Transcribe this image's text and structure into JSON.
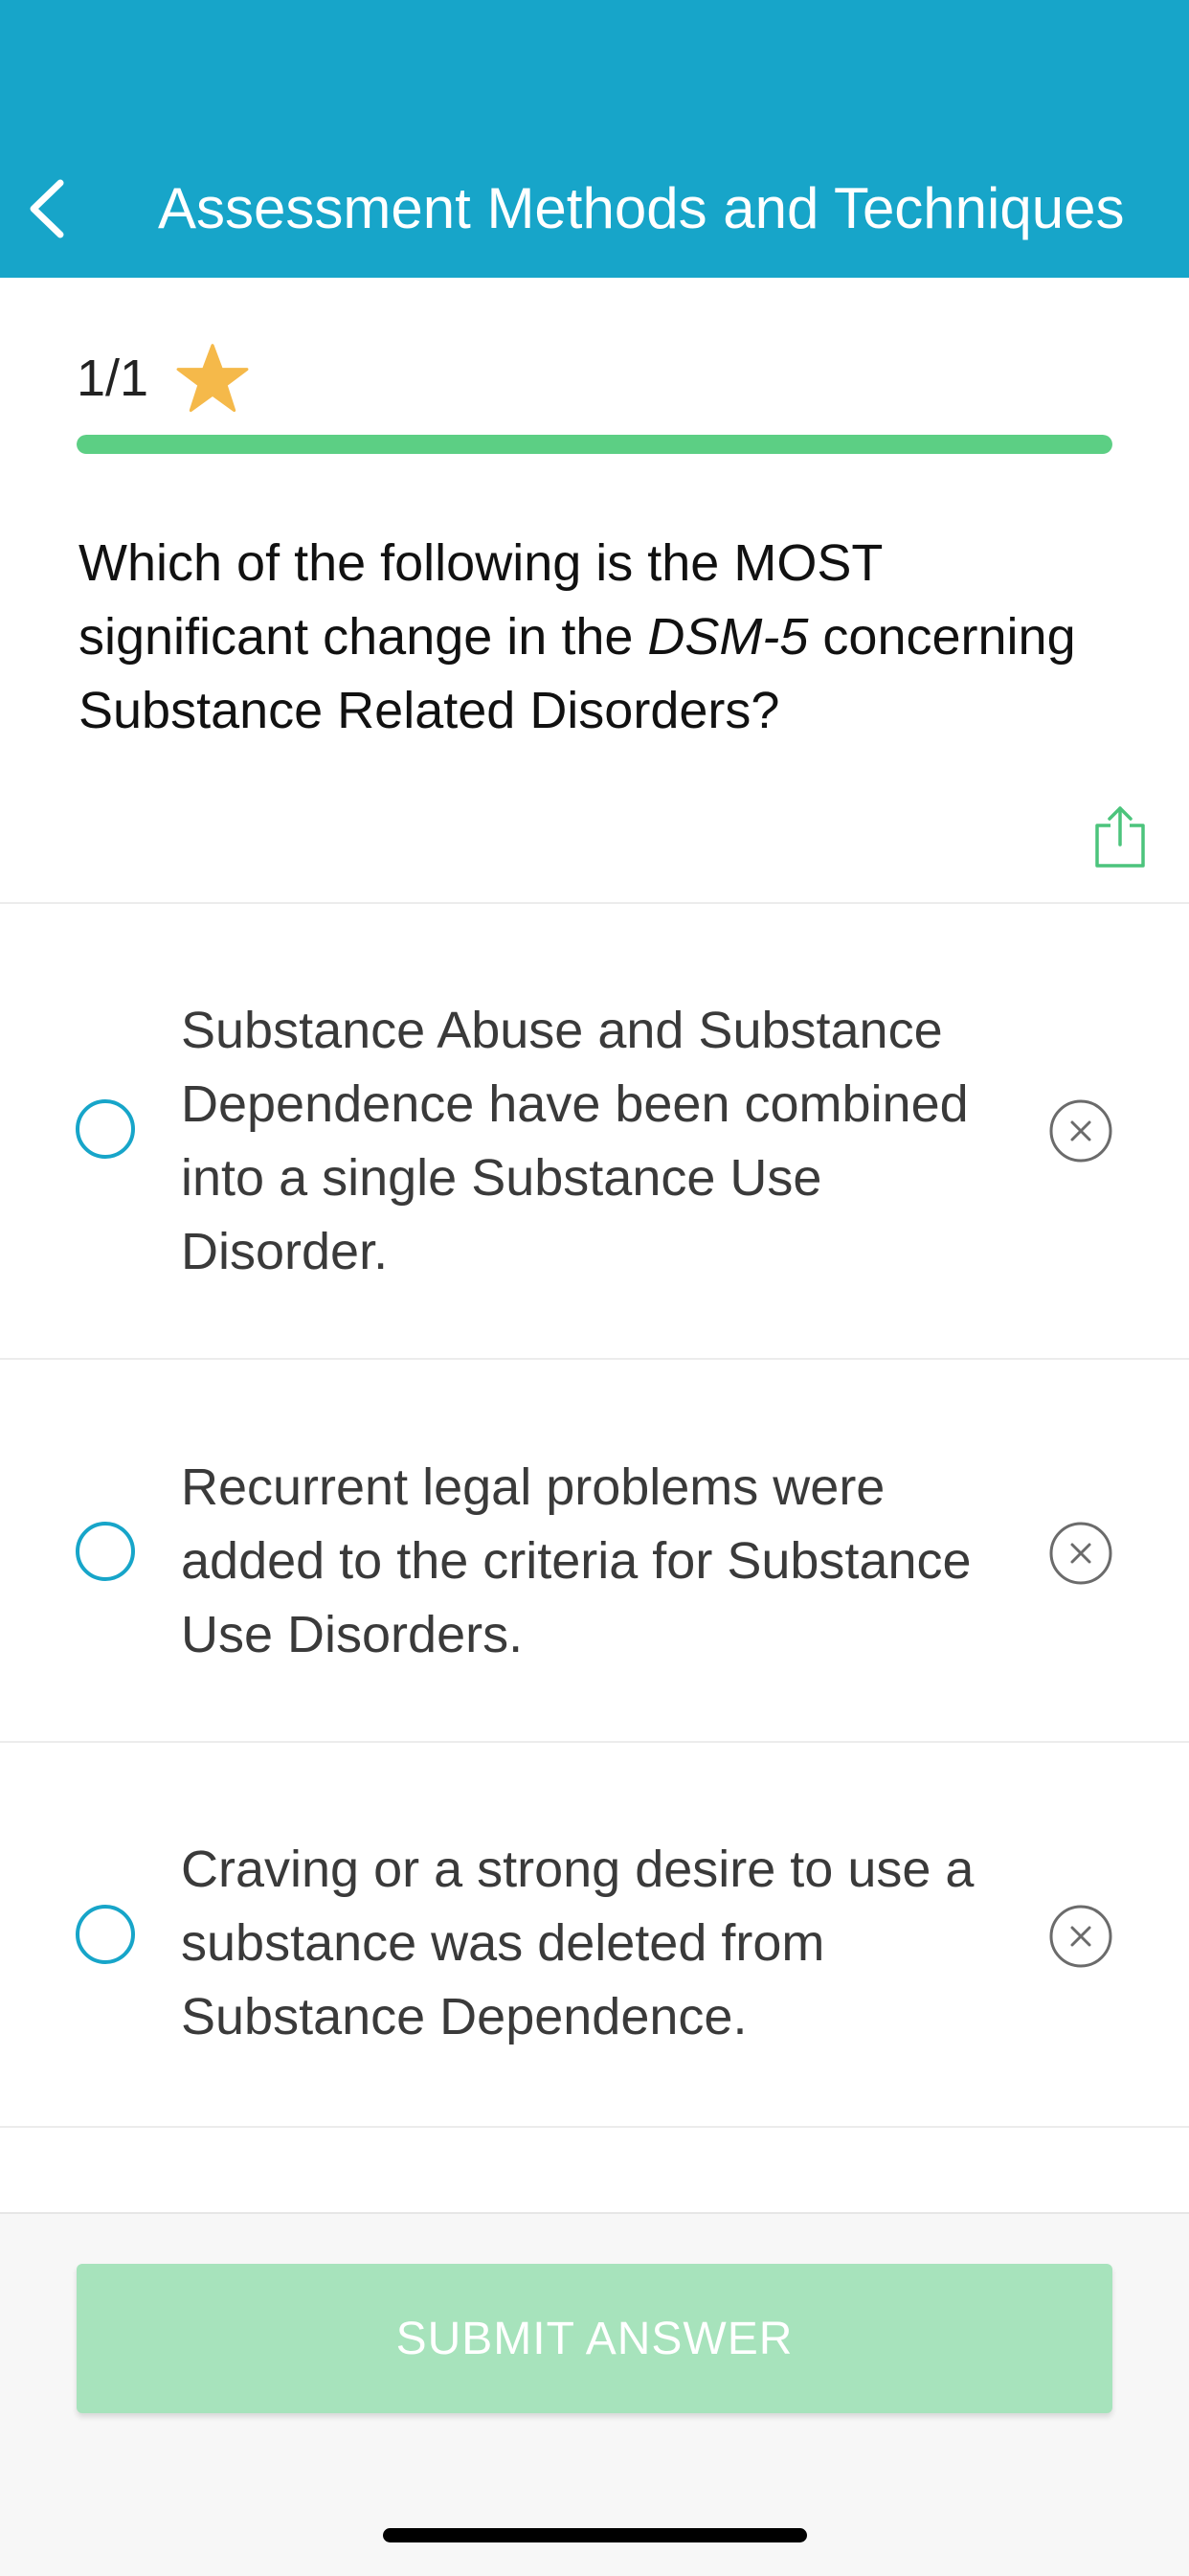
{
  "header": {
    "title": "Assessment Methods and Techniques",
    "back_icon": "chevron-left-icon",
    "background": "#17a5c9"
  },
  "progress": {
    "counter": "1/1",
    "fraction": 1.0,
    "star_icon": "star-icon",
    "star_color": "#f5b94a",
    "bar_color": "#5ccf84"
  },
  "question": {
    "text_before": "Which of the following is the MOST significant change in the ",
    "text_italic": "DSM-5",
    "text_after": " concerning Substance Related Disorders?",
    "share_icon": "share-icon"
  },
  "options": [
    {
      "text": "Substance Abuse and Substance Dependence have been combined into a single Substance Use Disorder."
    },
    {
      "text": "Recurrent legal problems were added to the criteria for Substance Use Disorders."
    },
    {
      "text": "Craving or a strong desire to use a substance was deleted from Substance Dependence."
    }
  ],
  "footer": {
    "submit_label": "SUBMIT ANSWER",
    "submit_color": "#a7e3bc"
  }
}
